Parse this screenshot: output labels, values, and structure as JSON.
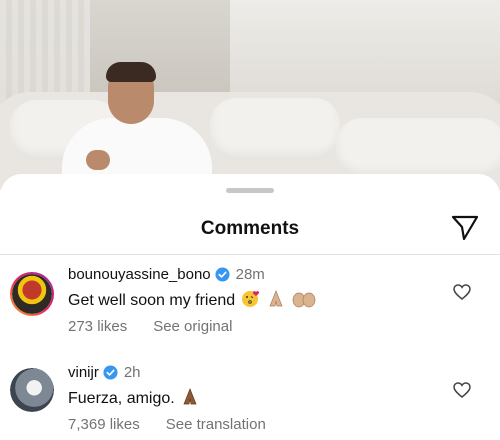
{
  "sheet": {
    "title": "Comments"
  },
  "comments": [
    {
      "username": "bounouyassine_bono",
      "verified": true,
      "time": "28m",
      "text": "Get well soon my friend",
      "emojis": [
        "kissing-face-with-heart",
        "folded-hands",
        "raised-hands"
      ],
      "likes": "273 likes",
      "action": "See original"
    },
    {
      "username": "vinijr",
      "verified": true,
      "time": "2h",
      "text": "Fuerza, amigo.",
      "emojis": [
        "folded-hands"
      ],
      "likes": "7,369 likes",
      "action": "See translation"
    }
  ],
  "colors": {
    "verified": "#3797f0",
    "secondary_text": "#737373",
    "primary_text": "#111111"
  }
}
